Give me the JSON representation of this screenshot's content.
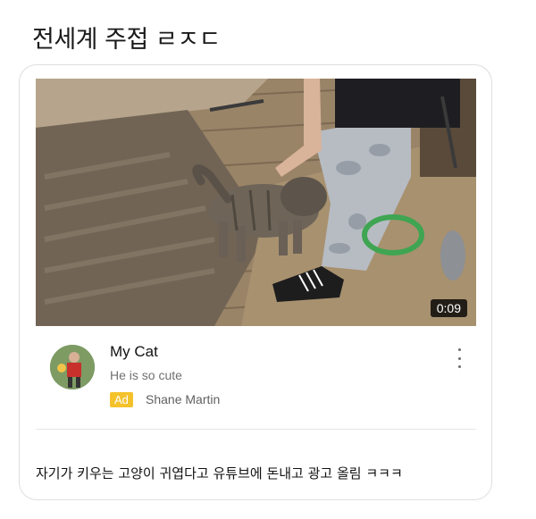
{
  "post": {
    "title": "전세계 주접 ㄹㅈㄷ",
    "caption": "자기가 키우는 고양이 귀엽다고 유튜브에 돈내고 광고 올림 ㅋㅋㅋ"
  },
  "ad_card": {
    "video_duration": "0:09",
    "video_title": "My Cat",
    "video_description": "He is so cute",
    "ad_badge_label": "Ad",
    "advertiser_name": "Shane Martin",
    "colors": {
      "ad_badge": "#f4c22b",
      "duration_bg": "#000000"
    },
    "icons": [
      "more-vert-icon"
    ]
  }
}
